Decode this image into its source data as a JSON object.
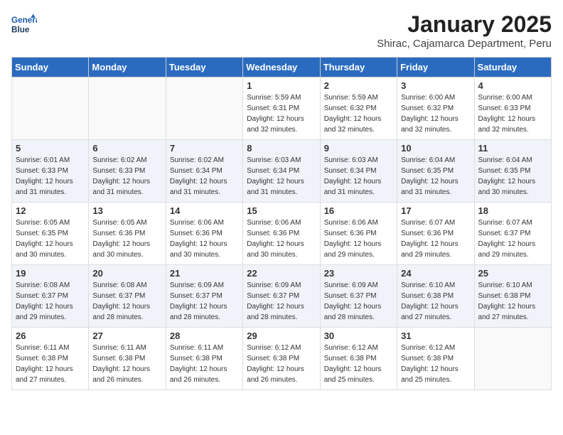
{
  "header": {
    "logo_line1": "General",
    "logo_line2": "Blue",
    "month": "January 2025",
    "location": "Shirac, Cajamarca Department, Peru"
  },
  "days_of_week": [
    "Sunday",
    "Monday",
    "Tuesday",
    "Wednesday",
    "Thursday",
    "Friday",
    "Saturday"
  ],
  "weeks": [
    [
      {
        "day": "",
        "sunrise": "",
        "sunset": "",
        "daylight": ""
      },
      {
        "day": "",
        "sunrise": "",
        "sunset": "",
        "daylight": ""
      },
      {
        "day": "",
        "sunrise": "",
        "sunset": "",
        "daylight": ""
      },
      {
        "day": "1",
        "sunrise": "Sunrise: 5:59 AM",
        "sunset": "Sunset: 6:31 PM",
        "daylight": "Daylight: 12 hours and 32 minutes."
      },
      {
        "day": "2",
        "sunrise": "Sunrise: 5:59 AM",
        "sunset": "Sunset: 6:32 PM",
        "daylight": "Daylight: 12 hours and 32 minutes."
      },
      {
        "day": "3",
        "sunrise": "Sunrise: 6:00 AM",
        "sunset": "Sunset: 6:32 PM",
        "daylight": "Daylight: 12 hours and 32 minutes."
      },
      {
        "day": "4",
        "sunrise": "Sunrise: 6:00 AM",
        "sunset": "Sunset: 6:33 PM",
        "daylight": "Daylight: 12 hours and 32 minutes."
      }
    ],
    [
      {
        "day": "5",
        "sunrise": "Sunrise: 6:01 AM",
        "sunset": "Sunset: 6:33 PM",
        "daylight": "Daylight: 12 hours and 31 minutes."
      },
      {
        "day": "6",
        "sunrise": "Sunrise: 6:02 AM",
        "sunset": "Sunset: 6:33 PM",
        "daylight": "Daylight: 12 hours and 31 minutes."
      },
      {
        "day": "7",
        "sunrise": "Sunrise: 6:02 AM",
        "sunset": "Sunset: 6:34 PM",
        "daylight": "Daylight: 12 hours and 31 minutes."
      },
      {
        "day": "8",
        "sunrise": "Sunrise: 6:03 AM",
        "sunset": "Sunset: 6:34 PM",
        "daylight": "Daylight: 12 hours and 31 minutes."
      },
      {
        "day": "9",
        "sunrise": "Sunrise: 6:03 AM",
        "sunset": "Sunset: 6:34 PM",
        "daylight": "Daylight: 12 hours and 31 minutes."
      },
      {
        "day": "10",
        "sunrise": "Sunrise: 6:04 AM",
        "sunset": "Sunset: 6:35 PM",
        "daylight": "Daylight: 12 hours and 31 minutes."
      },
      {
        "day": "11",
        "sunrise": "Sunrise: 6:04 AM",
        "sunset": "Sunset: 6:35 PM",
        "daylight": "Daylight: 12 hours and 30 minutes."
      }
    ],
    [
      {
        "day": "12",
        "sunrise": "Sunrise: 6:05 AM",
        "sunset": "Sunset: 6:35 PM",
        "daylight": "Daylight: 12 hours and 30 minutes."
      },
      {
        "day": "13",
        "sunrise": "Sunrise: 6:05 AM",
        "sunset": "Sunset: 6:36 PM",
        "daylight": "Daylight: 12 hours and 30 minutes."
      },
      {
        "day": "14",
        "sunrise": "Sunrise: 6:06 AM",
        "sunset": "Sunset: 6:36 PM",
        "daylight": "Daylight: 12 hours and 30 minutes."
      },
      {
        "day": "15",
        "sunrise": "Sunrise: 6:06 AM",
        "sunset": "Sunset: 6:36 PM",
        "daylight": "Daylight: 12 hours and 30 minutes."
      },
      {
        "day": "16",
        "sunrise": "Sunrise: 6:06 AM",
        "sunset": "Sunset: 6:36 PM",
        "daylight": "Daylight: 12 hours and 29 minutes."
      },
      {
        "day": "17",
        "sunrise": "Sunrise: 6:07 AM",
        "sunset": "Sunset: 6:36 PM",
        "daylight": "Daylight: 12 hours and 29 minutes."
      },
      {
        "day": "18",
        "sunrise": "Sunrise: 6:07 AM",
        "sunset": "Sunset: 6:37 PM",
        "daylight": "Daylight: 12 hours and 29 minutes."
      }
    ],
    [
      {
        "day": "19",
        "sunrise": "Sunrise: 6:08 AM",
        "sunset": "Sunset: 6:37 PM",
        "daylight": "Daylight: 12 hours and 29 minutes."
      },
      {
        "day": "20",
        "sunrise": "Sunrise: 6:08 AM",
        "sunset": "Sunset: 6:37 PM",
        "daylight": "Daylight: 12 hours and 28 minutes."
      },
      {
        "day": "21",
        "sunrise": "Sunrise: 6:09 AM",
        "sunset": "Sunset: 6:37 PM",
        "daylight": "Daylight: 12 hours and 28 minutes."
      },
      {
        "day": "22",
        "sunrise": "Sunrise: 6:09 AM",
        "sunset": "Sunset: 6:37 PM",
        "daylight": "Daylight: 12 hours and 28 minutes."
      },
      {
        "day": "23",
        "sunrise": "Sunrise: 6:09 AM",
        "sunset": "Sunset: 6:37 PM",
        "daylight": "Daylight: 12 hours and 28 minutes."
      },
      {
        "day": "24",
        "sunrise": "Sunrise: 6:10 AM",
        "sunset": "Sunset: 6:38 PM",
        "daylight": "Daylight: 12 hours and 27 minutes."
      },
      {
        "day": "25",
        "sunrise": "Sunrise: 6:10 AM",
        "sunset": "Sunset: 6:38 PM",
        "daylight": "Daylight: 12 hours and 27 minutes."
      }
    ],
    [
      {
        "day": "26",
        "sunrise": "Sunrise: 6:11 AM",
        "sunset": "Sunset: 6:38 PM",
        "daylight": "Daylight: 12 hours and 27 minutes."
      },
      {
        "day": "27",
        "sunrise": "Sunrise: 6:11 AM",
        "sunset": "Sunset: 6:38 PM",
        "daylight": "Daylight: 12 hours and 26 minutes."
      },
      {
        "day": "28",
        "sunrise": "Sunrise: 6:11 AM",
        "sunset": "Sunset: 6:38 PM",
        "daylight": "Daylight: 12 hours and 26 minutes."
      },
      {
        "day": "29",
        "sunrise": "Sunrise: 6:12 AM",
        "sunset": "Sunset: 6:38 PM",
        "daylight": "Daylight: 12 hours and 26 minutes."
      },
      {
        "day": "30",
        "sunrise": "Sunrise: 6:12 AM",
        "sunset": "Sunset: 6:38 PM",
        "daylight": "Daylight: 12 hours and 25 minutes."
      },
      {
        "day": "31",
        "sunrise": "Sunrise: 6:12 AM",
        "sunset": "Sunset: 6:38 PM",
        "daylight": "Daylight: 12 hours and 25 minutes."
      },
      {
        "day": "",
        "sunrise": "",
        "sunset": "",
        "daylight": ""
      }
    ]
  ]
}
